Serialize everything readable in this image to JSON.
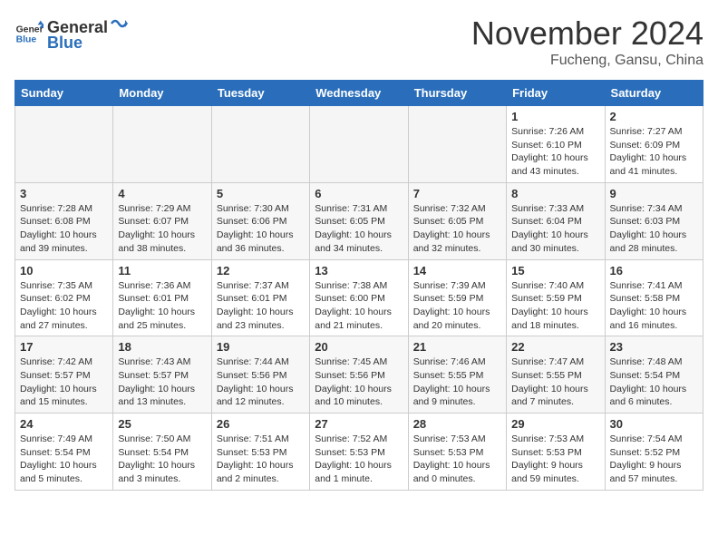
{
  "header": {
    "logo_general": "General",
    "logo_blue": "Blue",
    "month": "November 2024",
    "location": "Fucheng, Gansu, China"
  },
  "weekdays": [
    "Sunday",
    "Monday",
    "Tuesday",
    "Wednesday",
    "Thursday",
    "Friday",
    "Saturday"
  ],
  "weeks": [
    {
      "shade": "light",
      "days": [
        {
          "num": "",
          "info": "",
          "empty": true
        },
        {
          "num": "",
          "info": "",
          "empty": true
        },
        {
          "num": "",
          "info": "",
          "empty": true
        },
        {
          "num": "",
          "info": "",
          "empty": true
        },
        {
          "num": "",
          "info": "",
          "empty": true
        },
        {
          "num": "1",
          "info": "Sunrise: 7:26 AM\nSunset: 6:10 PM\nDaylight: 10 hours\nand 43 minutes."
        },
        {
          "num": "2",
          "info": "Sunrise: 7:27 AM\nSunset: 6:09 PM\nDaylight: 10 hours\nand 41 minutes."
        }
      ]
    },
    {
      "shade": "dark",
      "days": [
        {
          "num": "3",
          "info": "Sunrise: 7:28 AM\nSunset: 6:08 PM\nDaylight: 10 hours\nand 39 minutes."
        },
        {
          "num": "4",
          "info": "Sunrise: 7:29 AM\nSunset: 6:07 PM\nDaylight: 10 hours\nand 38 minutes."
        },
        {
          "num": "5",
          "info": "Sunrise: 7:30 AM\nSunset: 6:06 PM\nDaylight: 10 hours\nand 36 minutes."
        },
        {
          "num": "6",
          "info": "Sunrise: 7:31 AM\nSunset: 6:05 PM\nDaylight: 10 hours\nand 34 minutes."
        },
        {
          "num": "7",
          "info": "Sunrise: 7:32 AM\nSunset: 6:05 PM\nDaylight: 10 hours\nand 32 minutes."
        },
        {
          "num": "8",
          "info": "Sunrise: 7:33 AM\nSunset: 6:04 PM\nDaylight: 10 hours\nand 30 minutes."
        },
        {
          "num": "9",
          "info": "Sunrise: 7:34 AM\nSunset: 6:03 PM\nDaylight: 10 hours\nand 28 minutes."
        }
      ]
    },
    {
      "shade": "light",
      "days": [
        {
          "num": "10",
          "info": "Sunrise: 7:35 AM\nSunset: 6:02 PM\nDaylight: 10 hours\nand 27 minutes."
        },
        {
          "num": "11",
          "info": "Sunrise: 7:36 AM\nSunset: 6:01 PM\nDaylight: 10 hours\nand 25 minutes."
        },
        {
          "num": "12",
          "info": "Sunrise: 7:37 AM\nSunset: 6:01 PM\nDaylight: 10 hours\nand 23 minutes."
        },
        {
          "num": "13",
          "info": "Sunrise: 7:38 AM\nSunset: 6:00 PM\nDaylight: 10 hours\nand 21 minutes."
        },
        {
          "num": "14",
          "info": "Sunrise: 7:39 AM\nSunset: 5:59 PM\nDaylight: 10 hours\nand 20 minutes."
        },
        {
          "num": "15",
          "info": "Sunrise: 7:40 AM\nSunset: 5:59 PM\nDaylight: 10 hours\nand 18 minutes."
        },
        {
          "num": "16",
          "info": "Sunrise: 7:41 AM\nSunset: 5:58 PM\nDaylight: 10 hours\nand 16 minutes."
        }
      ]
    },
    {
      "shade": "dark",
      "days": [
        {
          "num": "17",
          "info": "Sunrise: 7:42 AM\nSunset: 5:57 PM\nDaylight: 10 hours\nand 15 minutes."
        },
        {
          "num": "18",
          "info": "Sunrise: 7:43 AM\nSunset: 5:57 PM\nDaylight: 10 hours\nand 13 minutes."
        },
        {
          "num": "19",
          "info": "Sunrise: 7:44 AM\nSunset: 5:56 PM\nDaylight: 10 hours\nand 12 minutes."
        },
        {
          "num": "20",
          "info": "Sunrise: 7:45 AM\nSunset: 5:56 PM\nDaylight: 10 hours\nand 10 minutes."
        },
        {
          "num": "21",
          "info": "Sunrise: 7:46 AM\nSunset: 5:55 PM\nDaylight: 10 hours\nand 9 minutes."
        },
        {
          "num": "22",
          "info": "Sunrise: 7:47 AM\nSunset: 5:55 PM\nDaylight: 10 hours\nand 7 minutes."
        },
        {
          "num": "23",
          "info": "Sunrise: 7:48 AM\nSunset: 5:54 PM\nDaylight: 10 hours\nand 6 minutes."
        }
      ]
    },
    {
      "shade": "light",
      "days": [
        {
          "num": "24",
          "info": "Sunrise: 7:49 AM\nSunset: 5:54 PM\nDaylight: 10 hours\nand 5 minutes."
        },
        {
          "num": "25",
          "info": "Sunrise: 7:50 AM\nSunset: 5:54 PM\nDaylight: 10 hours\nand 3 minutes."
        },
        {
          "num": "26",
          "info": "Sunrise: 7:51 AM\nSunset: 5:53 PM\nDaylight: 10 hours\nand 2 minutes."
        },
        {
          "num": "27",
          "info": "Sunrise: 7:52 AM\nSunset: 5:53 PM\nDaylight: 10 hours\nand 1 minute."
        },
        {
          "num": "28",
          "info": "Sunrise: 7:53 AM\nSunset: 5:53 PM\nDaylight: 10 hours\nand 0 minutes."
        },
        {
          "num": "29",
          "info": "Sunrise: 7:53 AM\nSunset: 5:53 PM\nDaylight: 9 hours\nand 59 minutes."
        },
        {
          "num": "30",
          "info": "Sunrise: 7:54 AM\nSunset: 5:52 PM\nDaylight: 9 hours\nand 57 minutes."
        }
      ]
    }
  ]
}
